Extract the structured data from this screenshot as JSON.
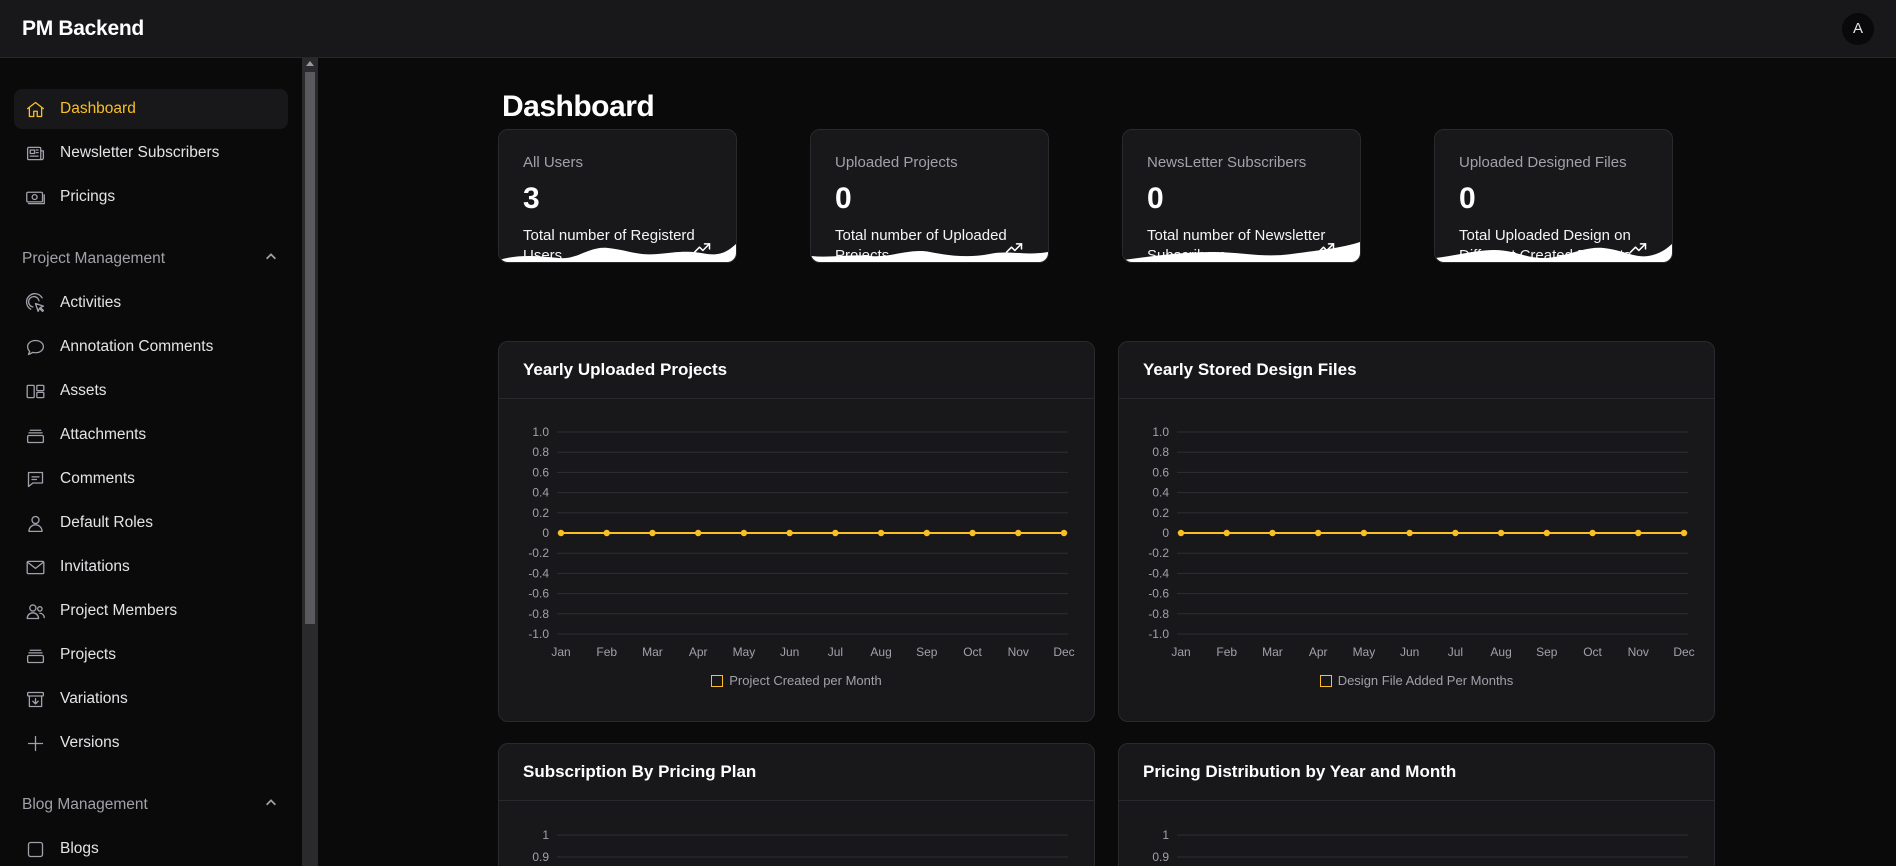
{
  "app": {
    "title": "PM Backend",
    "avatar_initial": "A"
  },
  "sidebar": {
    "top_items": [
      {
        "label": "Dashboard",
        "icon": "home-icon",
        "active": true
      },
      {
        "label": "Newsletter Subscribers",
        "icon": "newspaper-icon"
      },
      {
        "label": "Pricings",
        "icon": "banknotes-icon"
      }
    ],
    "groups": [
      {
        "label": "Project Management",
        "items": [
          {
            "label": "Activities",
            "icon": "cursor-click-icon"
          },
          {
            "label": "Annotation Comments",
            "icon": "chat-bubble-icon"
          },
          {
            "label": "Assets",
            "icon": "squares-icon"
          },
          {
            "label": "Attachments",
            "icon": "stack-icon"
          },
          {
            "label": "Comments",
            "icon": "chat-alt-icon"
          },
          {
            "label": "Default Roles",
            "icon": "user-icon"
          },
          {
            "label": "Invitations",
            "icon": "envelope-icon"
          },
          {
            "label": "Project Members",
            "icon": "users-icon"
          },
          {
            "label": "Projects",
            "icon": "stack-icon"
          },
          {
            "label": "Variations",
            "icon": "archive-down-icon"
          },
          {
            "label": "Versions",
            "icon": "plus-icon"
          }
        ]
      },
      {
        "label": "Blog Management",
        "items": [
          {
            "label": "Blogs",
            "icon": "square-icon"
          }
        ]
      }
    ]
  },
  "main": {
    "title": "Dashboard",
    "stats": [
      {
        "label": "All Users",
        "value": "3",
        "desc": "Total number of Registerd Users."
      },
      {
        "label": "Uploaded Projects",
        "value": "0",
        "desc": "Total number of Uploaded Projects"
      },
      {
        "label": "NewsLetter Subscribers",
        "value": "0",
        "desc": "Total number of Newsletter Subscribers."
      },
      {
        "label": "Uploaded Designed Files",
        "value": "0",
        "desc": "Total Uploaded Design on Different Created Projects."
      }
    ],
    "panels": [
      {
        "title": "Yearly Uploaded Projects"
      },
      {
        "title": "Yearly Stored Design Files"
      },
      {
        "title": "Subscription By Pricing Plan"
      },
      {
        "title": "Pricing Distribution by Year and Month"
      }
    ]
  },
  "colors": {
    "accent": "#fbbf24",
    "background": "#0a0a0b",
    "card": "#18181b",
    "border": "#2a2a2e"
  },
  "chart_data": [
    {
      "type": "line",
      "title": "Yearly Uploaded Projects",
      "categories": [
        "Jan",
        "Feb",
        "Mar",
        "Apr",
        "May",
        "Jun",
        "Jul",
        "Aug",
        "Sep",
        "Oct",
        "Nov",
        "Dec"
      ],
      "series": [
        {
          "name": "Project Created per Month",
          "values": [
            0,
            0,
            0,
            0,
            0,
            0,
            0,
            0,
            0,
            0,
            0,
            0
          ]
        }
      ],
      "yticks": [
        "1.0",
        "0.8",
        "0.6",
        "0.4",
        "0.2",
        "0",
        "-0.2",
        "-0.4",
        "-0.6",
        "-0.8",
        "-1.0"
      ],
      "ylim": [
        -1,
        1
      ],
      "grid": true,
      "legend": "bottom"
    },
    {
      "type": "line",
      "title": "Yearly Stored Design Files",
      "categories": [
        "Jan",
        "Feb",
        "Mar",
        "Apr",
        "May",
        "Jun",
        "Jul",
        "Aug",
        "Sep",
        "Oct",
        "Nov",
        "Dec"
      ],
      "series": [
        {
          "name": "Design File Added Per Months",
          "values": [
            0,
            0,
            0,
            0,
            0,
            0,
            0,
            0,
            0,
            0,
            0,
            0
          ]
        }
      ],
      "yticks": [
        "1.0",
        "0.8",
        "0.6",
        "0.4",
        "0.2",
        "0",
        "-0.2",
        "-0.4",
        "-0.6",
        "-0.8",
        "-1.0"
      ],
      "ylim": [
        -1,
        1
      ],
      "grid": true,
      "legend": "bottom"
    },
    {
      "type": "bar",
      "title": "Subscription By Pricing Plan",
      "yticks": [
        "1",
        "0.9"
      ]
    },
    {
      "type": "bar",
      "title": "Pricing Distribution by Year and Month",
      "yticks": [
        "1",
        "0.9"
      ]
    }
  ]
}
